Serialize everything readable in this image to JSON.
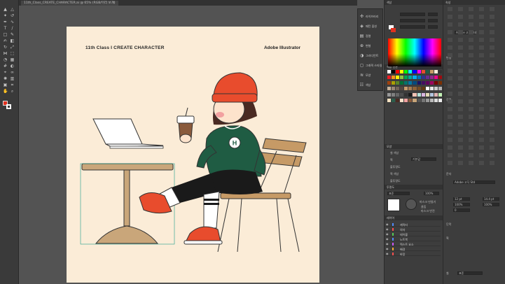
{
  "window": {
    "tab_title": "11th_Class_CREATE_CHARACTER.ai @ 65% (RGB/미리 보기)",
    "tab_close": "×"
  },
  "tools": [
    {
      "name": "selection-tool-icon",
      "glyph": "▲"
    },
    {
      "name": "direct-selection-tool-icon",
      "glyph": "△"
    },
    {
      "name": "magic-wand-icon",
      "glyph": "✦"
    },
    {
      "name": "lasso-icon",
      "glyph": "↺"
    },
    {
      "name": "pen-tool-icon",
      "glyph": "✒"
    },
    {
      "name": "curvature-tool-icon",
      "glyph": "∿"
    },
    {
      "name": "type-tool-icon",
      "glyph": "T"
    },
    {
      "name": "line-tool-icon",
      "glyph": "/"
    },
    {
      "name": "rectangle-tool-icon",
      "glyph": "□"
    },
    {
      "name": "paintbrush-icon",
      "glyph": "✎"
    },
    {
      "name": "shaper-icon",
      "glyph": "✍"
    },
    {
      "name": "eraser-icon",
      "glyph": "◧"
    },
    {
      "name": "rotate-icon",
      "glyph": "↻"
    },
    {
      "name": "scale-icon",
      "glyph": "⤢"
    },
    {
      "name": "width-tool-icon",
      "glyph": "⋈"
    },
    {
      "name": "free-transform-icon",
      "glyph": "⬚"
    },
    {
      "name": "shape-builder-icon",
      "glyph": "◔"
    },
    {
      "name": "perspective-icon",
      "glyph": "▦"
    },
    {
      "name": "mesh-icon",
      "glyph": "#"
    },
    {
      "name": "gradient-icon",
      "glyph": "◐"
    },
    {
      "name": "eyedropper-icon",
      "glyph": "⌖"
    },
    {
      "name": "blend-icon",
      "glyph": "∞"
    },
    {
      "name": "symbol-sprayer-icon",
      "glyph": "✺"
    },
    {
      "name": "graph-tool-icon",
      "glyph": "▥"
    },
    {
      "name": "artboard-tool-icon",
      "glyph": "▣"
    },
    {
      "name": "slice-tool-icon",
      "glyph": "⌗"
    },
    {
      "name": "hand-tool-icon",
      "glyph": "✋"
    },
    {
      "name": "zoom-tool-icon",
      "glyph": "⌕"
    }
  ],
  "artboard": {
    "left_title": "11th Class  I  CREATE  CHARACTER",
    "right_title": "Adobe Illustrator",
    "logo_letter": "H"
  },
  "flyout": {
    "items": [
      {
        "icon": "✣",
        "label": "라이브러리"
      },
      {
        "icon": "◈",
        "label": "패턴 옵션"
      },
      {
        "icon": "▤",
        "label": "정렬"
      },
      {
        "icon": "⊕",
        "label": "변형"
      },
      {
        "icon": "◑",
        "label": "그라디언트"
      },
      {
        "icon": "◻",
        "label": "그래픽 스타일"
      },
      {
        "icon": "≋",
        "label": "모양"
      },
      {
        "icon": "☷",
        "label": "색상"
      }
    ]
  },
  "color_panel": {
    "title": "색상"
  },
  "swatches_panel": {
    "title": "색상 견본"
  },
  "appearance_panel": {
    "title": "모양",
    "items": [
      "칠 색상",
      "획",
      "불투명도",
      "획 색상",
      "불투명도"
    ],
    "opacity_label": "기본값"
  },
  "transparency_panel": {
    "title": "투명도",
    "mode": "표준",
    "opacity": "100%",
    "option_label": "마스크 만들기",
    "clip_label": "클립",
    "invert_label": "마스크 반전"
  },
  "layers_panel": {
    "title": "레이어",
    "layers": [
      {
        "name": "캐릭터",
        "color": "#4f8cff"
      },
      {
        "name": "의자",
        "color": "#ff4f4f"
      },
      {
        "name": "테이블",
        "color": "#55cc55"
      },
      {
        "name": "노트북",
        "color": "#4f8cff"
      },
      {
        "name": "텍스트 요소",
        "color": "#cc55ff"
      },
      {
        "name": "배경",
        "color": "#ffaa33"
      },
      {
        "name": "바탕",
        "color": "#ff4f4f"
      }
    ]
  },
  "properties_panel": {
    "title": "속성",
    "sections": [
      "변형",
      "정렬",
      "문자",
      "단락",
      "획",
      "칠"
    ],
    "font_family": "Adobe 고딕 Std",
    "font_size": "12 pt",
    "leading": "14.4 pt",
    "scale_h": "100%",
    "scale_v": "100%",
    "tracking": "0",
    "blend_label": "표준"
  },
  "colors": {
    "artboard": "#fbecd7",
    "hat": "#e84c2d",
    "sweater": "#1f5c43",
    "shoes": "#e84c2d",
    "chair": "#c69a66",
    "table": "#c9a67a"
  }
}
